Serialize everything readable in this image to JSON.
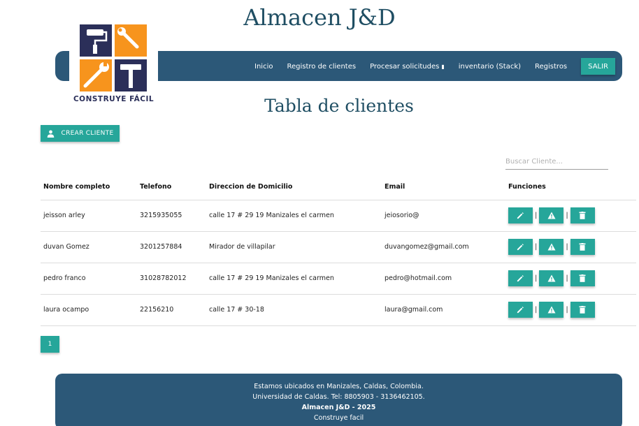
{
  "header": {
    "site_title": "Almacen J&D"
  },
  "logo": {
    "text": "CONSTRUYE FÁCIL"
  },
  "nav": {
    "items": [
      {
        "label": "Inicio"
      },
      {
        "label": "Registro de clientes"
      },
      {
        "label": "Procesar solicitudes"
      },
      {
        "label": "inventario (Stack)"
      },
      {
        "label": "Registros"
      }
    ],
    "logout_label": "SALIR"
  },
  "main": {
    "page_title": "Tabla de clientes",
    "create_button_label": "CREAR CLIENTE",
    "search_placeholder": "Buscar Cliente...",
    "table": {
      "headers": [
        "Nombre completo",
        "Telefono",
        "Direccion de Domicilio",
        "Email",
        "Funciones"
      ],
      "rows": [
        {
          "nombre": "jeisson arley",
          "telefono": "3215935055",
          "direccion": "calle 17 # 29 19 Manizales el carmen",
          "email": "jeiosorio@"
        },
        {
          "nombre": "duvan Gomez",
          "telefono": "3201257884",
          "direccion": "Mirador de villapilar",
          "email": "duvangomez@gmail.com"
        },
        {
          "nombre": "pedro franco",
          "telefono": "31028782012",
          "direccion": "calle 17 # 29 19 Manizales el carmen",
          "email": "pedro@hotmail.com"
        },
        {
          "nombre": "laura ocampo",
          "telefono": "22156210",
          "direccion": "calle 17 # 30-18",
          "email": "laura@gmail.com"
        }
      ],
      "action_icons": [
        "edit-icon",
        "warning-icon",
        "delete-icon"
      ],
      "separator": "|"
    },
    "pagination": {
      "current_page": "1"
    }
  },
  "footer": {
    "line1": "Estamos ubicados en Manizales, Caldas, Colombia.",
    "line2": "Universidad de Caldas. Tel: 8805903 - 3136462105.",
    "line3": "Almacen J&D - 2025",
    "line4": "Construye facil"
  },
  "colors": {
    "navy": "#2c5878",
    "teal": "#26a69a",
    "title": "#1f4e63",
    "logo_orange": "#f7941d",
    "logo_navy": "#2b2f59"
  }
}
